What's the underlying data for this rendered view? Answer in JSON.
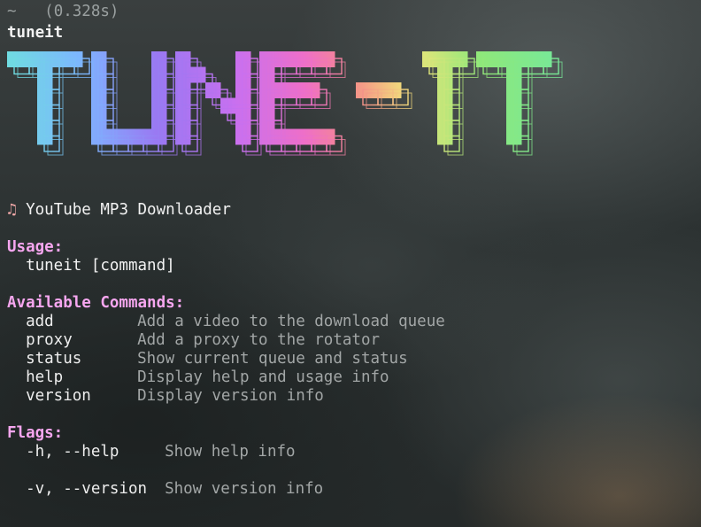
{
  "prompt": {
    "dir": "~",
    "timing": "(0.328s)"
  },
  "command_line": "tuneit",
  "banner": {
    "text": "TUNE - IT",
    "colors": [
      "#6ee0de",
      "#7db4ff",
      "#9a78f2",
      "#c870f0",
      "#ee6fc8",
      "#f58a8a",
      "#f0e47a",
      "#8fe87a",
      "#6ee8a4"
    ]
  },
  "subtitle": {
    "icon": "music-note-icon",
    "text": "YouTube MP3 Downloader"
  },
  "usage": {
    "heading": "Usage:",
    "line": "tuneit [command]"
  },
  "commands": {
    "heading": "Available Commands:",
    "items": [
      {
        "name": "add",
        "desc": "Add a video to the download queue"
      },
      {
        "name": "proxy",
        "desc": "Add a proxy to the rotator"
      },
      {
        "name": "status",
        "desc": "Show current queue and status"
      },
      {
        "name": "help",
        "desc": "Display help and usage info"
      },
      {
        "name": "version",
        "desc": "Display version info"
      }
    ]
  },
  "flags": {
    "heading": "Flags:",
    "items": [
      {
        "name": "-h, --help",
        "desc": "Show help info"
      },
      {
        "name": "-v, --version",
        "desc": "Show version info"
      }
    ]
  }
}
